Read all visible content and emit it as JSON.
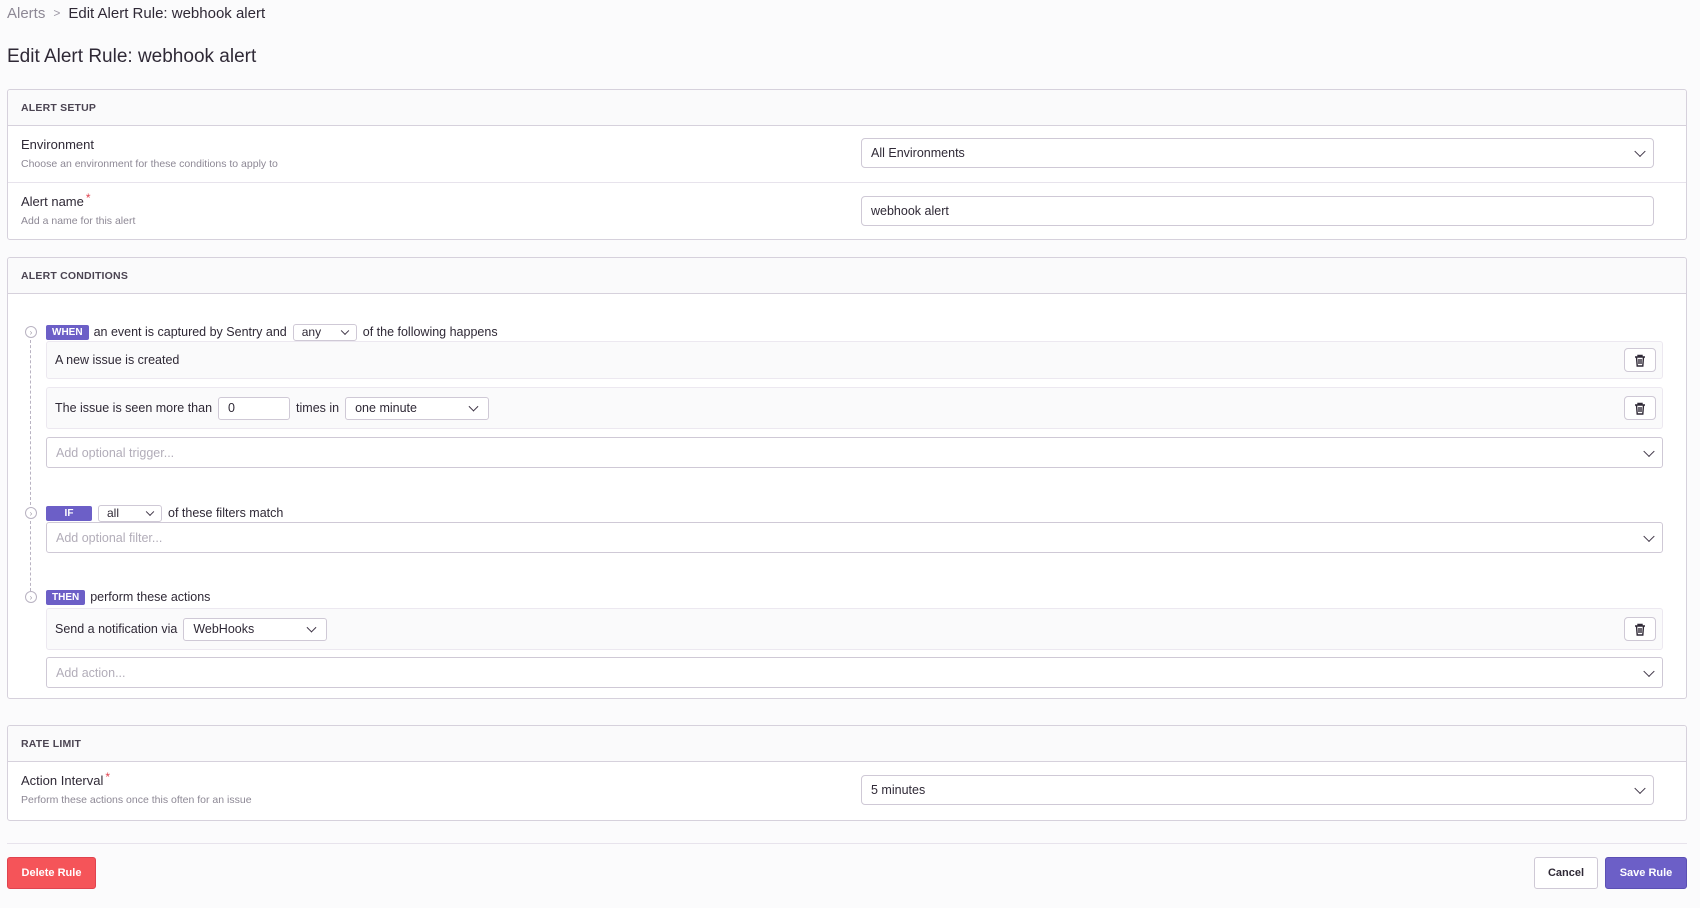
{
  "breadcrumb": {
    "parent": "Alerts",
    "separator": ">",
    "current": "Edit Alert Rule: webhook alert"
  },
  "page_title": "Edit Alert Rule: webhook alert",
  "alert_setup": {
    "header": "ALERT SETUP",
    "environment": {
      "label": "Environment",
      "help": "Choose an environment for these conditions to apply to",
      "value": "All Environments"
    },
    "alert_name": {
      "label": "Alert name",
      "required_mark": "*",
      "help": "Add a name for this alert",
      "value": "webhook alert"
    }
  },
  "alert_conditions": {
    "header": "ALERT CONDITIONS",
    "when": {
      "badge": "WHEN",
      "text_before": "an event is captured by Sentry and",
      "match": "any",
      "text_after": "of the following happens",
      "step_icon": "chevron-right-icon",
      "conditions": [
        {
          "text": "A new issue is created"
        },
        {
          "text_before": "The issue is seen more than",
          "count_value": "0",
          "text_mid": "times in",
          "interval": "one minute"
        }
      ],
      "add_placeholder": "Add optional trigger..."
    },
    "if": {
      "badge": "IF",
      "match": "all",
      "text_after": "of these filters match",
      "add_placeholder": "Add optional filter..."
    },
    "then": {
      "badge": "THEN",
      "text_after": "perform these actions",
      "actions": [
        {
          "text_before": "Send a notification via",
          "service": "WebHooks"
        }
      ],
      "add_placeholder": "Add action..."
    }
  },
  "rate_limit": {
    "header": "RATE LIMIT",
    "action_interval": {
      "label": "Action Interval",
      "required_mark": "*",
      "help": "Perform these actions once this often for an issue",
      "value": "5 minutes"
    }
  },
  "footer": {
    "delete_label": "Delete Rule",
    "cancel_label": "Cancel",
    "save_label": "Save Rule"
  },
  "colors": {
    "accent": "#6c5fc7",
    "danger": "#f55459"
  }
}
